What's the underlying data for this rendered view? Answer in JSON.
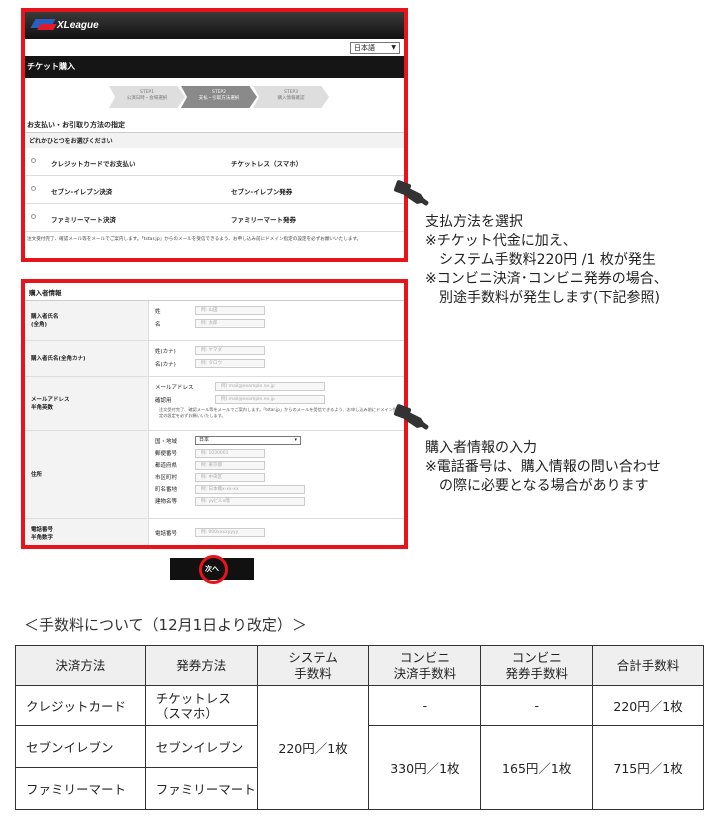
{
  "site": {
    "logo_text": "XLeague",
    "language": "日本語",
    "page_title": "チケット購入",
    "steps": [
      {
        "label": "STEP1",
        "desc": "公演日時・会場選択"
      },
      {
        "label": "STEP2",
        "desc": "支払・引取方法選択"
      },
      {
        "label": "STEP3",
        "desc": "購入情報確認"
      }
    ],
    "active_step": 2
  },
  "payment": {
    "heading": "お支払い・お引取り方法の指定",
    "subheading": "どれかひとつをお選びください",
    "options": [
      {
        "pay": "クレジットカードでお支払い",
        "pickup": "チケットレス（スマホ）"
      },
      {
        "pay": "セブン-イレブン決済",
        "pickup": "セブン-イレブン発券"
      },
      {
        "pay": "ファミリーマート決済",
        "pickup": "ファミリーマート発券"
      }
    ],
    "notice": "注文受付完了、確認メール等をメールでご案内します。「tstar.jp」からのメールを受信できるよう、お申し込み前にドメイン指定の設定を必ずお願いいたします。"
  },
  "purchaser": {
    "heading": "購入者情報",
    "rows": [
      {
        "label": "購入者氏名\n(全角)",
        "fields": [
          {
            "name": "姓",
            "ph": "例: 山田"
          },
          {
            "name": "名",
            "ph": "例: 太郎"
          }
        ]
      },
      {
        "label": "購入者氏名(全角カナ)",
        "fields": [
          {
            "name": "姓(カナ)",
            "ph": "例: ヤマダ"
          },
          {
            "name": "名(カナ)",
            "ph": "例: タロウ"
          }
        ]
      },
      {
        "label": "メールアドレス\n半角英数",
        "fields": [
          {
            "name": "メールアドレス",
            "ph": "例) mail@example.ne.jp"
          },
          {
            "name": "確認用",
            "ph": "例) mail@example.ne.jp"
          }
        ]
      },
      {
        "label": "住所",
        "fields": [
          {
            "name": "国・地域",
            "ph": "日本"
          },
          {
            "name": "郵便番号",
            "ph": "例: 1030001"
          },
          {
            "name": "都道府県",
            "ph": "例: 東京都"
          },
          {
            "name": "市区町村",
            "ph": "例: 中央区"
          },
          {
            "name": "町名番地",
            "ph": "例: 日本橋x-xx-xx"
          },
          {
            "name": "建物名等",
            "ph": "例: yyビルx階"
          }
        ]
      },
      {
        "label": "電話番号\n半角数字",
        "fields": [
          {
            "name": "電話番号",
            "ph": "例: 000xxxxyyyy"
          }
        ]
      }
    ],
    "email_note": "注文受付完了、確認メール等をメールでご案内します。「tstar.jp」からのメールを受信できるよう、お申し込み前にドメイン指定の設定を必ずお願いいたします。"
  },
  "next_button": "次へ",
  "annotations": {
    "payment": [
      "支払方法を選択",
      "※チケット代金に加え、",
      "　システム手数料220円 /1 枚が発生",
      "※コンビニ決済･コンビニ発券の場合、",
      "　別途手数料が発生します(下記参照)"
    ],
    "purchaser": [
      "購入者情報の入力",
      "※電話番号は、購入情報の問い合わせ",
      "　の際に必要となる場合があります"
    ]
  },
  "fees": {
    "title": "＜手数料について（12月1日より改定）＞",
    "headers": [
      "決済方法",
      "発券方法",
      "システム\n手数料",
      "コンビニ\n決済手数料",
      "コンビニ\n発券手数料",
      "合計手数料"
    ],
    "rows": [
      {
        "pay": "クレジットカード",
        "pickup": "チケットレス\n（スマホ）",
        "settle": "-",
        "issue": "-",
        "total": "220円／1枚"
      },
      {
        "pay": "セブンイレブン",
        "pickup": "セブンイレブン"
      },
      {
        "pay": "ファミリーマート",
        "pickup": "ファミリーマート"
      }
    ],
    "system_fee": "220円／1枚",
    "conv_settle": "330円／1枚",
    "conv_issue": "165円／1枚",
    "conv_total": "715円／1枚"
  },
  "colors": {
    "highlight": "#e8141c",
    "header_bg": "#151515"
  }
}
